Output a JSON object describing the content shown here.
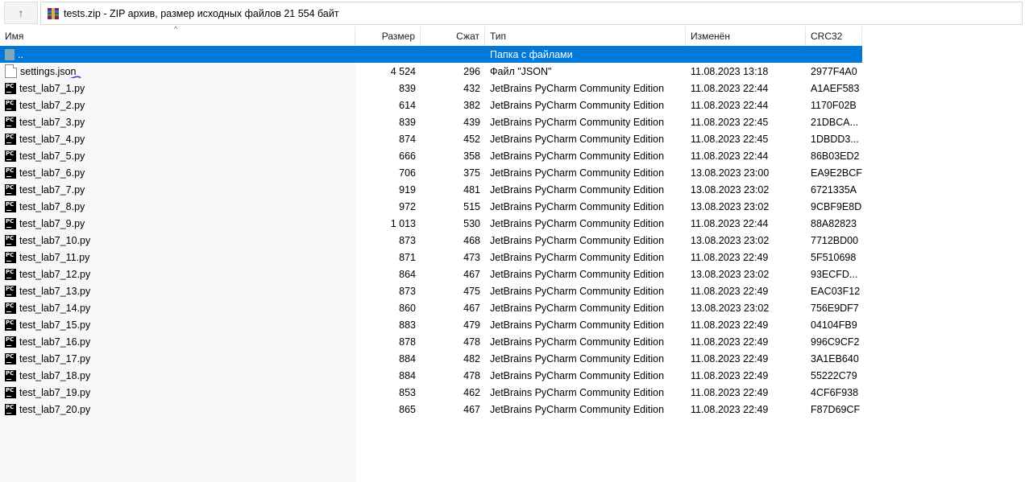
{
  "toolbar": {
    "up_icon": "up-arrow-icon",
    "address": "tests.zip - ZIP архив, размер исходных файлов 21 554 байт",
    "archive_icon": "winrar-archive-icon"
  },
  "columns": {
    "name": "Имя",
    "size": "Размер",
    "packed": "Сжат",
    "type": "Тип",
    "modified": "Изменён",
    "crc": "CRC32"
  },
  "parent_row": {
    "name": "..",
    "type": "Папка с файлами"
  },
  "files": [
    {
      "name": "settings.json",
      "size": "4 524",
      "packed": "296",
      "type": "Файл \"JSON\"",
      "modified": "11.08.2023 13:18",
      "crc": "2977F4A0",
      "icon": "document-icon"
    },
    {
      "name": "test_lab7_1.py",
      "size": "839",
      "packed": "432",
      "type": "JetBrains PyCharm Community Edition",
      "modified": "11.08.2023 22:44",
      "crc": "A1AEF583",
      "icon": "pycharm-icon"
    },
    {
      "name": "test_lab7_2.py",
      "size": "614",
      "packed": "382",
      "type": "JetBrains PyCharm Community Edition",
      "modified": "11.08.2023 22:44",
      "crc": "1170F02B",
      "icon": "pycharm-icon"
    },
    {
      "name": "test_lab7_3.py",
      "size": "839",
      "packed": "439",
      "type": "JetBrains PyCharm Community Edition",
      "modified": "11.08.2023 22:45",
      "crc": "21DBCA...",
      "icon": "pycharm-icon"
    },
    {
      "name": "test_lab7_4.py",
      "size": "874",
      "packed": "452",
      "type": "JetBrains PyCharm Community Edition",
      "modified": "11.08.2023 22:45",
      "crc": "1DBDD3...",
      "icon": "pycharm-icon"
    },
    {
      "name": "test_lab7_5.py",
      "size": "666",
      "packed": "358",
      "type": "JetBrains PyCharm Community Edition",
      "modified": "11.08.2023 22:44",
      "crc": "86B03ED2",
      "icon": "pycharm-icon"
    },
    {
      "name": "test_lab7_6.py",
      "size": "706",
      "packed": "375",
      "type": "JetBrains PyCharm Community Edition",
      "modified": "13.08.2023 23:00",
      "crc": "EA9E2BCF",
      "icon": "pycharm-icon"
    },
    {
      "name": "test_lab7_7.py",
      "size": "919",
      "packed": "481",
      "type": "JetBrains PyCharm Community Edition",
      "modified": "13.08.2023 23:02",
      "crc": "6721335A",
      "icon": "pycharm-icon"
    },
    {
      "name": "test_lab7_8.py",
      "size": "972",
      "packed": "515",
      "type": "JetBrains PyCharm Community Edition",
      "modified": "13.08.2023 23:02",
      "crc": "9CBF9E8D",
      "icon": "pycharm-icon"
    },
    {
      "name": "test_lab7_9.py",
      "size": "1 013",
      "packed": "530",
      "type": "JetBrains PyCharm Community Edition",
      "modified": "11.08.2023 22:44",
      "crc": "88A82823",
      "icon": "pycharm-icon"
    },
    {
      "name": "test_lab7_10.py",
      "size": "873",
      "packed": "468",
      "type": "JetBrains PyCharm Community Edition",
      "modified": "13.08.2023 23:02",
      "crc": "7712BD00",
      "icon": "pycharm-icon"
    },
    {
      "name": "test_lab7_11.py",
      "size": "871",
      "packed": "473",
      "type": "JetBrains PyCharm Community Edition",
      "modified": "11.08.2023 22:49",
      "crc": "5F510698",
      "icon": "pycharm-icon"
    },
    {
      "name": "test_lab7_12.py",
      "size": "864",
      "packed": "467",
      "type": "JetBrains PyCharm Community Edition",
      "modified": "13.08.2023 23:02",
      "crc": "93ECFD...",
      "icon": "pycharm-icon"
    },
    {
      "name": "test_lab7_13.py",
      "size": "873",
      "packed": "475",
      "type": "JetBrains PyCharm Community Edition",
      "modified": "11.08.2023 22:49",
      "crc": "EAC03F12",
      "icon": "pycharm-icon"
    },
    {
      "name": "test_lab7_14.py",
      "size": "860",
      "packed": "467",
      "type": "JetBrains PyCharm Community Edition",
      "modified": "13.08.2023 23:02",
      "crc": "756E9DF7",
      "icon": "pycharm-icon"
    },
    {
      "name": "test_lab7_15.py",
      "size": "883",
      "packed": "479",
      "type": "JetBrains PyCharm Community Edition",
      "modified": "11.08.2023 22:49",
      "crc": "04104FB9",
      "icon": "pycharm-icon"
    },
    {
      "name": "test_lab7_16.py",
      "size": "878",
      "packed": "478",
      "type": "JetBrains PyCharm Community Edition",
      "modified": "11.08.2023 22:49",
      "crc": "996C9CF2",
      "icon": "pycharm-icon"
    },
    {
      "name": "test_lab7_17.py",
      "size": "884",
      "packed": "482",
      "type": "JetBrains PyCharm Community Edition",
      "modified": "11.08.2023 22:49",
      "crc": "3A1EB640",
      "icon": "pycharm-icon"
    },
    {
      "name": "test_lab7_18.py",
      "size": "884",
      "packed": "478",
      "type": "JetBrains PyCharm Community Edition",
      "modified": "11.08.2023 22:49",
      "crc": "55222C79",
      "icon": "pycharm-icon"
    },
    {
      "name": "test_lab7_19.py",
      "size": "853",
      "packed": "462",
      "type": "JetBrains PyCharm Community Edition",
      "modified": "11.08.2023 22:49",
      "crc": "4CF6F938",
      "icon": "pycharm-icon"
    },
    {
      "name": "test_lab7_20.py",
      "size": "865",
      "packed": "467",
      "type": "JetBrains PyCharm Community Edition",
      "modified": "11.08.2023 22:49",
      "crc": "F87D69CF",
      "icon": "pycharm-icon"
    }
  ],
  "colors": {
    "selection": "#0078d7",
    "annotation": "#1f3fd0",
    "pycharm_icon": "#000000"
  }
}
